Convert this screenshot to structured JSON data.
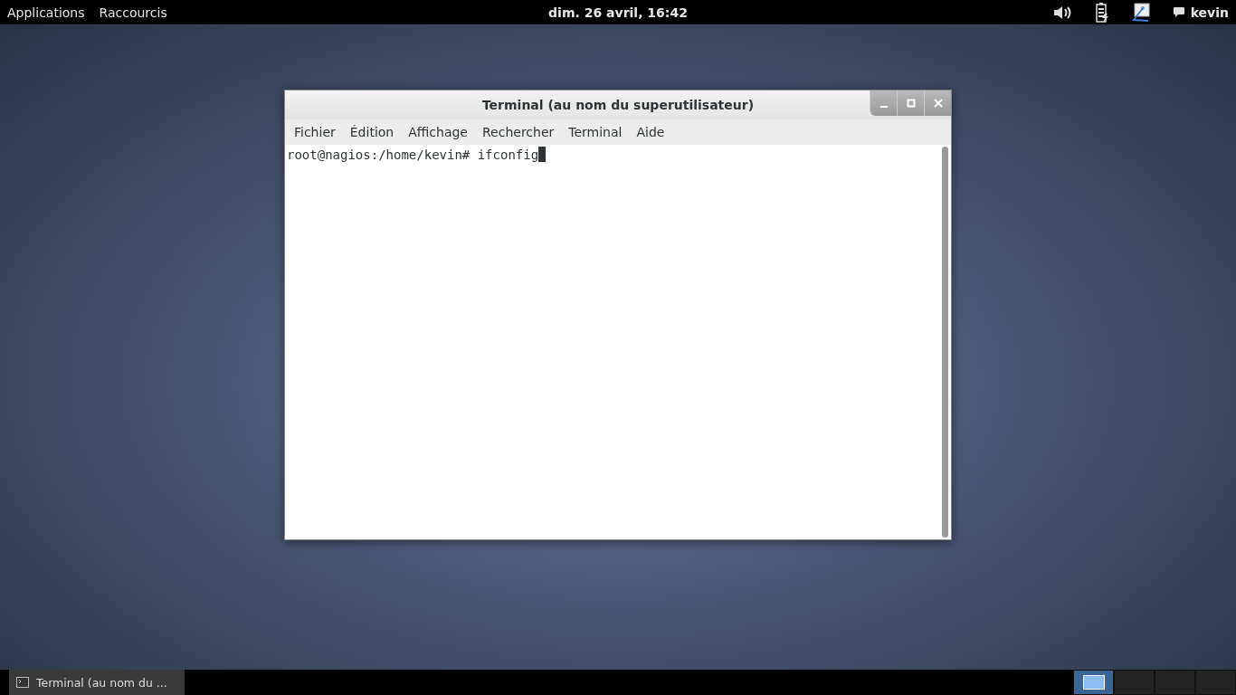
{
  "top_bar": {
    "menus": [
      "Applications",
      "Raccourcis"
    ],
    "clock": "dim. 26 avril, 16:42",
    "user": "kevin"
  },
  "window": {
    "title": "Terminal (au nom du superutilisateur)",
    "menu": [
      "Fichier",
      "Édition",
      "Affichage",
      "Rechercher",
      "Terminal",
      "Aide"
    ],
    "prompt": "root@nagios:/home/kevin#",
    "command": "ifconfig"
  },
  "taskbar": {
    "tasks": [
      {
        "label": "Terminal (au nom du ...",
        "selected": true
      }
    ],
    "workspaces": [
      {
        "selected": true
      },
      {
        "selected": false
      },
      {
        "selected": false
      },
      {
        "selected": false
      }
    ]
  }
}
